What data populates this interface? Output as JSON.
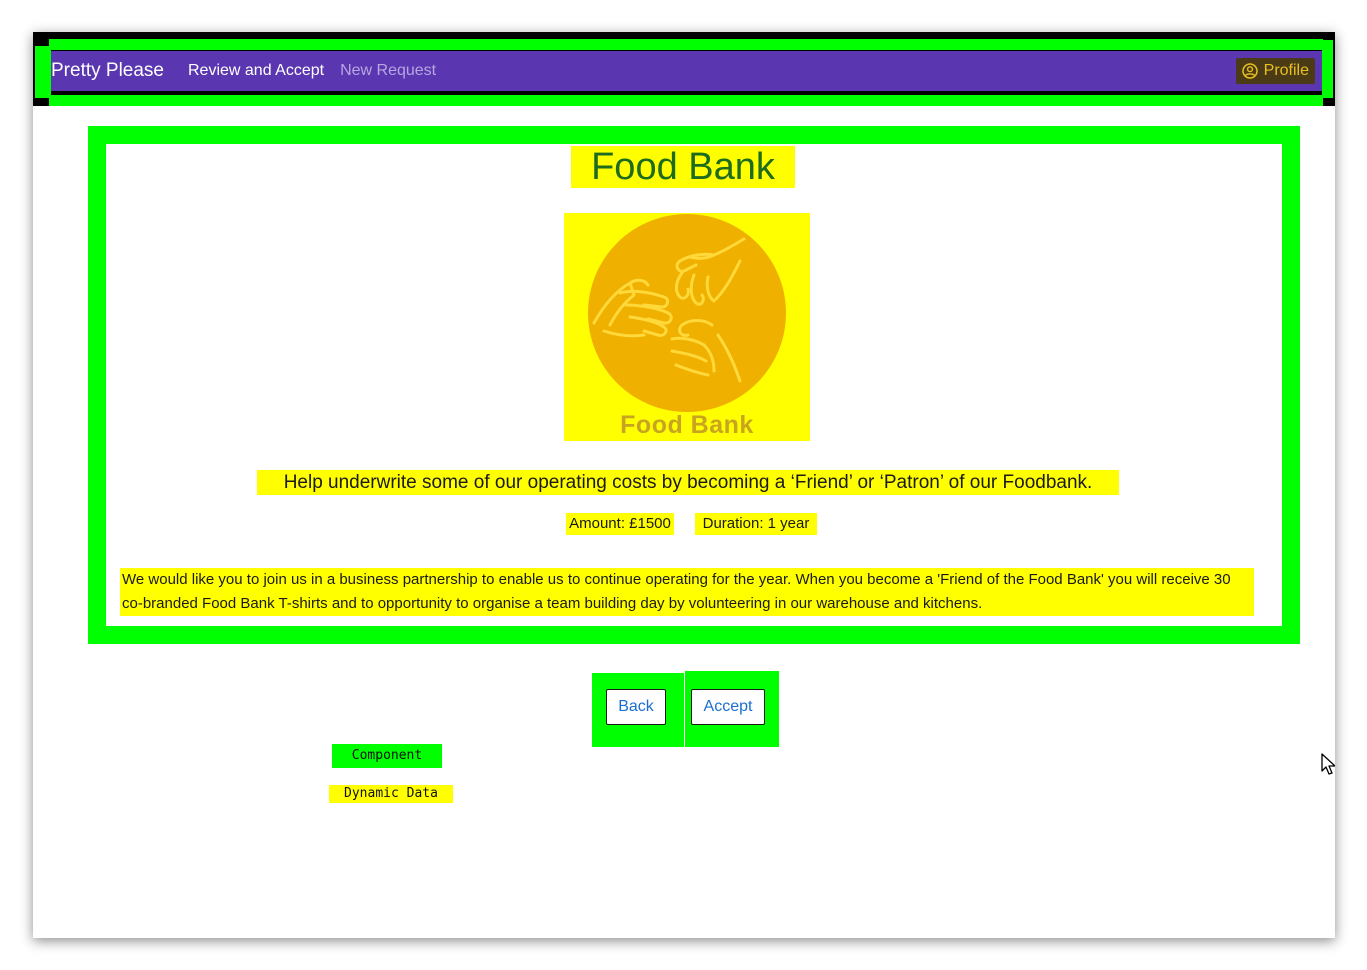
{
  "nav": {
    "brand": "Pretty Please",
    "links": [
      {
        "label": "Review and Accept"
      },
      {
        "label": "New Request"
      }
    ],
    "profile_label": "Profile"
  },
  "card": {
    "title": "Food Bank",
    "logo_text": "Food Bank",
    "tagline": "Help underwrite some of our operating costs by becoming a ‘Friend’ or ‘Patron’ of our Foodbank.",
    "amount": "Amount: £1500",
    "duration": "Duration: 1 year",
    "description": "We would like you to join us in a business partnership to enable us to continue operating for the year. When you become a 'Friend of the Food Bank' you will receive 30 co-branded Food Bank T-shirts and to opportunity to organise a team building day by volunteering in our warehouse and kitchens."
  },
  "buttons": {
    "back": "Back",
    "accept": "Accept"
  },
  "labels": {
    "component": "Component",
    "dynamic_data": "Dynamic Data"
  },
  "colors": {
    "navbar": "#5a37b1",
    "highlight_green": "#00ff00",
    "highlight_yellow": "#ffff00",
    "title_text": "#1e6b1e",
    "logo_circle": "#f0b000",
    "link_blue": "#1a6fd1"
  },
  "icons": {
    "profile": "user-circle-icon",
    "logo": "hands-icon",
    "cursor": "mouse-pointer-icon"
  }
}
